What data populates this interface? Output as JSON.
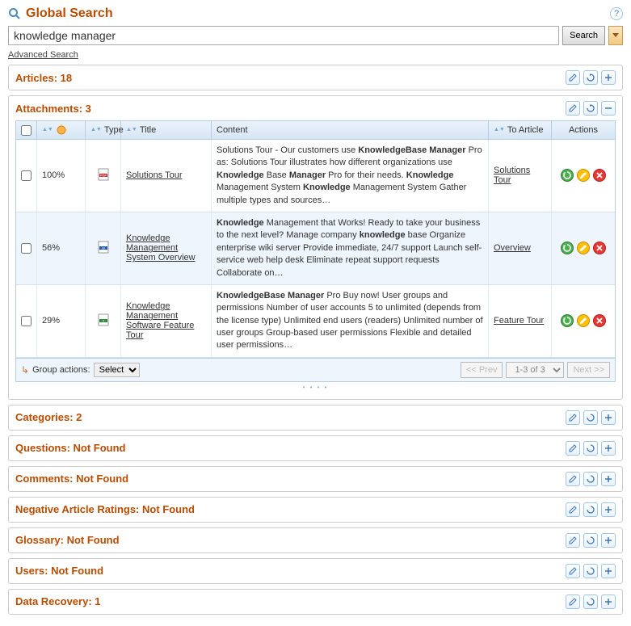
{
  "header": {
    "title": "Global Search",
    "help_label": "?"
  },
  "search": {
    "value": "knowledge manager",
    "button_label": "Search",
    "advanced_label": "Advanced Search"
  },
  "sections": {
    "articles": "Articles: 18",
    "attachments": "Attachments: 3",
    "categories": "Categories: 2",
    "questions": "Questions: Not Found",
    "comments": "Comments: Not Found",
    "neg_ratings": "Negative Article Ratings: Not Found",
    "glossary": "Glossary: Not Found",
    "users": "Users: Not Found",
    "data_recovery": "Data Recovery: 1"
  },
  "grid": {
    "headers": {
      "type": "Type",
      "title": "Title",
      "content": "Content",
      "to_article": "To Article",
      "actions": "Actions"
    },
    "group_actions_label": "Group actions:",
    "group_actions_select": "Select",
    "pager": {
      "prev": "<< Prev",
      "range": "1-3 of 3",
      "next": "Next >>"
    },
    "rows": [
      {
        "relevance": "100%",
        "filetype": "pdf",
        "title": "Solutions Tour",
        "content": "Solutions Tour - Our customers use <b>KnowledgeBase Manager</b> Pro as: Solutions Tour illustrates how different organizations use <b>Knowledge</b> Base <b>Manager</b> Pro for their needs. <b>Knowledge</b> Management System <b>Knowledge</b> Management System Gather multiple types and sources…",
        "to_article": "Solutions Tour"
      },
      {
        "relevance": "56%",
        "filetype": "doc",
        "title": "Knowledge Management System Overview",
        "content": "<b>Knowledge</b> Management that Works! Ready to take your business to the next level? Manage company <b>knowledge</b> base Organize enterprise wiki server Provide immediate, 24/7 support Launch self-service web help desk Eliminate repeat support requests Collaborate on…",
        "to_article": "Overview"
      },
      {
        "relevance": "29%",
        "filetype": "xls",
        "title": "Knowledge Management Software Feature Tour",
        "content": "<b>KnowledgeBase Manager</b> Pro Buy now! User groups and permissions Number of user accounts 5 to unlimited (depends from the license type) Unlimited end users (readers) Unlimited number of user groups Group-based user permissions Flexible and detailed user permissions…",
        "to_article": "Feature Tour"
      }
    ]
  }
}
